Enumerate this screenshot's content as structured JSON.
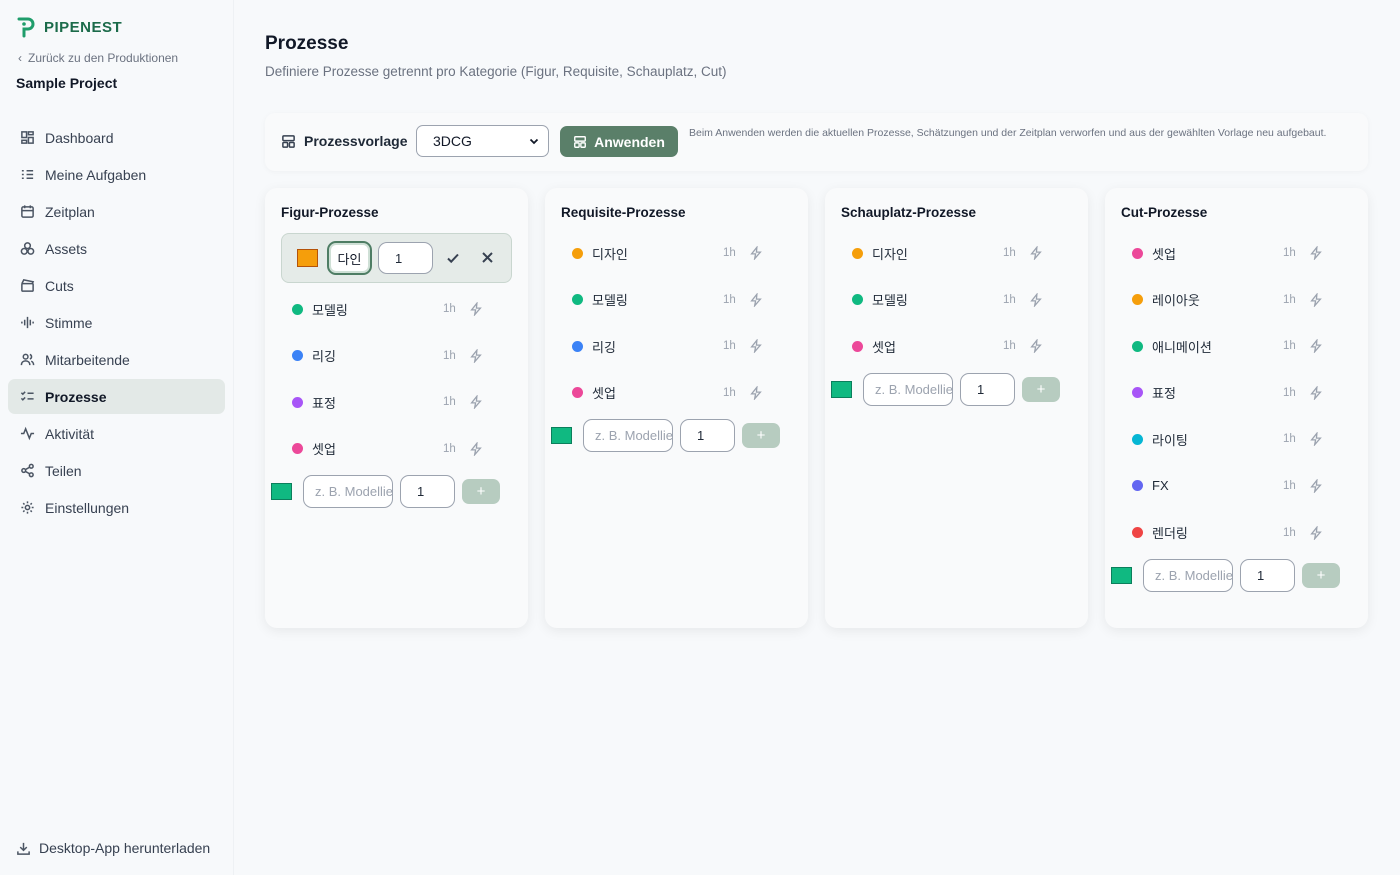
{
  "brand": {
    "name": "PIPENEST"
  },
  "sidebar": {
    "back_label": "Zurück zu den Produktionen",
    "project_name": "Sample Project",
    "items": [
      {
        "label": "Dashboard",
        "icon": "dashboard-icon"
      },
      {
        "label": "Meine Aufgaben",
        "icon": "task-list-icon"
      },
      {
        "label": "Zeitplan",
        "icon": "calendar-icon"
      },
      {
        "label": "Assets",
        "icon": "shapes-icon"
      },
      {
        "label": "Cuts",
        "icon": "clapperboard-icon"
      },
      {
        "label": "Stimme",
        "icon": "audio-wave-icon"
      },
      {
        "label": "Mitarbeitende",
        "icon": "users-icon"
      },
      {
        "label": "Prozesse",
        "icon": "checklist-icon",
        "active": true
      },
      {
        "label": "Aktivität",
        "icon": "activity-icon"
      },
      {
        "label": "Teilen",
        "icon": "share-icon"
      },
      {
        "label": "Einstellungen",
        "icon": "gear-icon"
      }
    ],
    "download_label": "Desktop-App herunterladen"
  },
  "header": {
    "title": "Prozesse",
    "subtitle": "Definiere Prozesse getrennt pro Kategorie (Figur, Requisite, Schauplatz, Cut)"
  },
  "template_bar": {
    "label": "Prozessvorlage",
    "selected": "3DCG",
    "apply_label": "Anwenden",
    "note": "Beim Anwenden werden die aktuellen Prozesse, Schätzungen und der Zeitplan verworfen und aus der gewählten Vorlage neu aufgebaut."
  },
  "colors": {
    "accent": "#5a7f69",
    "orange": "#f59e0b",
    "green": "#10b981",
    "blue": "#3b82f6",
    "purple": "#a855f7",
    "pink": "#ec4899",
    "cyan": "#06b6d4",
    "indigo": "#6366f1",
    "red": "#ef4444"
  },
  "new_process": {
    "placeholder": "z. B. Modellierung",
    "default_count": "1",
    "add_label": "+"
  },
  "editing": {
    "name": "다인",
    "count": "1",
    "swatch_color": "#f59e0b"
  },
  "cards": [
    {
      "title": "Figur-Prozesse",
      "editing_first": true,
      "processes": [
        {
          "name": "모델링",
          "duration": "1h",
          "color": "#10b981"
        },
        {
          "name": "리깅",
          "duration": "1h",
          "color": "#3b82f6"
        },
        {
          "name": "표정",
          "duration": "1h",
          "color": "#a855f7"
        },
        {
          "name": "셋업",
          "duration": "1h",
          "color": "#ec4899"
        }
      ]
    },
    {
      "title": "Requisite-Prozesse",
      "processes": [
        {
          "name": "디자인",
          "duration": "1h",
          "color": "#f59e0b"
        },
        {
          "name": "모델링",
          "duration": "1h",
          "color": "#10b981"
        },
        {
          "name": "리깅",
          "duration": "1h",
          "color": "#3b82f6"
        },
        {
          "name": "셋업",
          "duration": "1h",
          "color": "#ec4899"
        }
      ]
    },
    {
      "title": "Schauplatz-Prozesse",
      "processes": [
        {
          "name": "디자인",
          "duration": "1h",
          "color": "#f59e0b"
        },
        {
          "name": "모델링",
          "duration": "1h",
          "color": "#10b981"
        },
        {
          "name": "셋업",
          "duration": "1h",
          "color": "#ec4899"
        }
      ]
    },
    {
      "title": "Cut-Prozesse",
      "processes": [
        {
          "name": "셋업",
          "duration": "1h",
          "color": "#ec4899"
        },
        {
          "name": "레이아웃",
          "duration": "1h",
          "color": "#f59e0b"
        },
        {
          "name": "애니메이션",
          "duration": "1h",
          "color": "#10b981"
        },
        {
          "name": "표정",
          "duration": "1h",
          "color": "#a855f7"
        },
        {
          "name": "라이팅",
          "duration": "1h",
          "color": "#06b6d4"
        },
        {
          "name": "FX",
          "duration": "1h",
          "color": "#6366f1"
        },
        {
          "name": "렌더링",
          "duration": "1h",
          "color": "#ef4444"
        }
      ]
    }
  ]
}
